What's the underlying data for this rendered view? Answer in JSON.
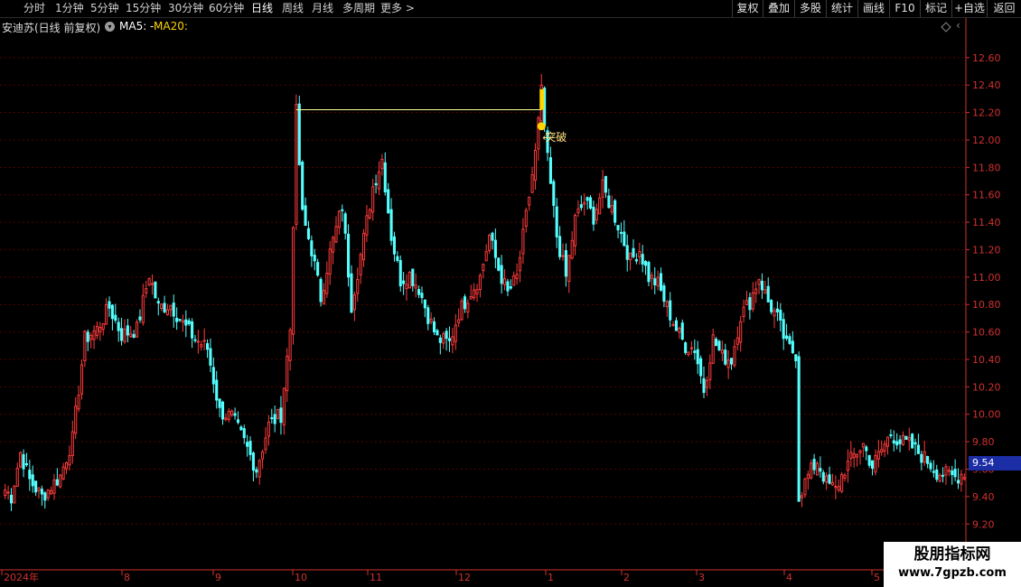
{
  "toolbar": {
    "periods": [
      "分时",
      "1分钟",
      "5分钟",
      "15分钟",
      "30分钟",
      "60分钟",
      "日线",
      "周线",
      "月线",
      "多周期",
      "更多 >"
    ],
    "active_period": "日线",
    "buttons": [
      "复权",
      "叠加",
      "多股",
      "统计",
      "画线",
      "F10",
      "标记",
      "+自选",
      "返回"
    ]
  },
  "info": {
    "title": "安迪苏(日线 前复权)",
    "ma5": "MA5: -",
    "ma20": "MA20:"
  },
  "price_axis": [
    "12.60",
    "12.40",
    "12.20",
    "12.00",
    "11.80",
    "11.60",
    "11.40",
    "11.20",
    "11.00",
    "10.80",
    "10.60",
    "10.40",
    "10.20",
    "10.00",
    "9.80",
    "9.60",
    "9.40",
    "9.20"
  ],
  "current_price": "9.54",
  "time_axis": [
    "2024年",
    "8",
    "9",
    "10",
    "11",
    "12",
    "1",
    "2",
    "3",
    "4",
    "5"
  ],
  "annotation": {
    "label": "突破"
  },
  "watermark": {
    "title": "股朋指标网",
    "url": "www.7gpzb.com"
  },
  "colors": {
    "up": "#ff3b3b",
    "down": "#54ffff",
    "grid": "#5a0000",
    "axis_text": "#d03030",
    "marker": "#ffd400"
  },
  "chart_data": {
    "type": "candlestick",
    "ylim": [
      9.07,
      12.77
    ],
    "x": [
      "2024年",
      "8",
      "9",
      "10",
      "11",
      "12",
      "1",
      "2",
      "3",
      "4",
      "5"
    ],
    "y_ticks": [
      12.6,
      12.4,
      12.2,
      12.0,
      11.8,
      11.6,
      11.4,
      11.2,
      11.0,
      10.8,
      10.6,
      10.4,
      10.2,
      10.0,
      9.8,
      9.6,
      9.4,
      9.2
    ],
    "anchors": [
      [
        0,
        9.45
      ],
      [
        2,
        9.4
      ],
      [
        5,
        9.72
      ],
      [
        8,
        9.52
      ],
      [
        12,
        9.4
      ],
      [
        18,
        9.55
      ],
      [
        22,
        9.82
      ],
      [
        26,
        10.55
      ],
      [
        30,
        10.62
      ],
      [
        34,
        10.78
      ],
      [
        38,
        10.58
      ],
      [
        43,
        10.62
      ],
      [
        47,
        11.02
      ],
      [
        50,
        10.78
      ],
      [
        54,
        10.8
      ],
      [
        58,
        10.66
      ],
      [
        62,
        10.55
      ],
      [
        66,
        10.48
      ],
      [
        70,
        10.02
      ],
      [
        74,
        9.98
      ],
      [
        78,
        9.8
      ],
      [
        82,
        9.6
      ],
      [
        86,
        9.92
      ],
      [
        90,
        10.0
      ],
      [
        93,
        10.62
      ],
      [
        95,
        12.2
      ],
      [
        97,
        11.45
      ],
      [
        100,
        11.2
      ],
      [
        103,
        10.85
      ],
      [
        106,
        11.18
      ],
      [
        110,
        11.52
      ],
      [
        113,
        10.8
      ],
      [
        117,
        11.28
      ],
      [
        120,
        11.66
      ],
      [
        123,
        11.86
      ],
      [
        126,
        11.3
      ],
      [
        129,
        10.98
      ],
      [
        132,
        11.02
      ],
      [
        135,
        10.92
      ],
      [
        138,
        10.72
      ],
      [
        141,
        10.55
      ],
      [
        145,
        10.52
      ],
      [
        148,
        10.74
      ],
      [
        151,
        10.86
      ],
      [
        155,
        11.0
      ],
      [
        158,
        11.3
      ],
      [
        161,
        11.06
      ],
      [
        164,
        10.88
      ],
      [
        167,
        11.0
      ],
      [
        170,
        11.44
      ],
      [
        173,
        11.9
      ],
      [
        175,
        12.35
      ],
      [
        177,
        11.85
      ],
      [
        180,
        11.3
      ],
      [
        183,
        11.0
      ],
      [
        186,
        11.42
      ],
      [
        189,
        11.55
      ],
      [
        192,
        11.44
      ],
      [
        195,
        11.65
      ],
      [
        198,
        11.5
      ],
      [
        201,
        11.32
      ],
      [
        204,
        11.12
      ],
      [
        207,
        11.2
      ],
      [
        210,
        11.0
      ],
      [
        213,
        10.95
      ],
      [
        216,
        10.78
      ],
      [
        219,
        10.62
      ],
      [
        222,
        10.5
      ],
      [
        225,
        10.48
      ],
      [
        228,
        10.18
      ],
      [
        231,
        10.55
      ],
      [
        234,
        10.42
      ],
      [
        237,
        10.4
      ],
      [
        240,
        10.72
      ],
      [
        243,
        10.82
      ],
      [
        246,
        11.0
      ],
      [
        249,
        10.82
      ],
      [
        252,
        10.7
      ],
      [
        255,
        10.5
      ],
      [
        258,
        10.44
      ],
      [
        259,
        9.4
      ],
      [
        262,
        9.55
      ],
      [
        265,
        9.66
      ],
      [
        268,
        9.5
      ],
      [
        271,
        9.45
      ],
      [
        274,
        9.6
      ],
      [
        277,
        9.7
      ],
      [
        280,
        9.78
      ],
      [
        283,
        9.62
      ],
      [
        286,
        9.74
      ],
      [
        289,
        9.86
      ],
      [
        292,
        9.8
      ],
      [
        295,
        9.78
      ],
      [
        298,
        9.72
      ],
      [
        301,
        9.66
      ],
      [
        304,
        9.58
      ],
      [
        307,
        9.56
      ],
      [
        310,
        9.54
      ],
      [
        313,
        9.58
      ]
    ],
    "breakout": {
      "from_price": 12.22,
      "to_price": 12.22,
      "marker_price": 12.1
    }
  }
}
